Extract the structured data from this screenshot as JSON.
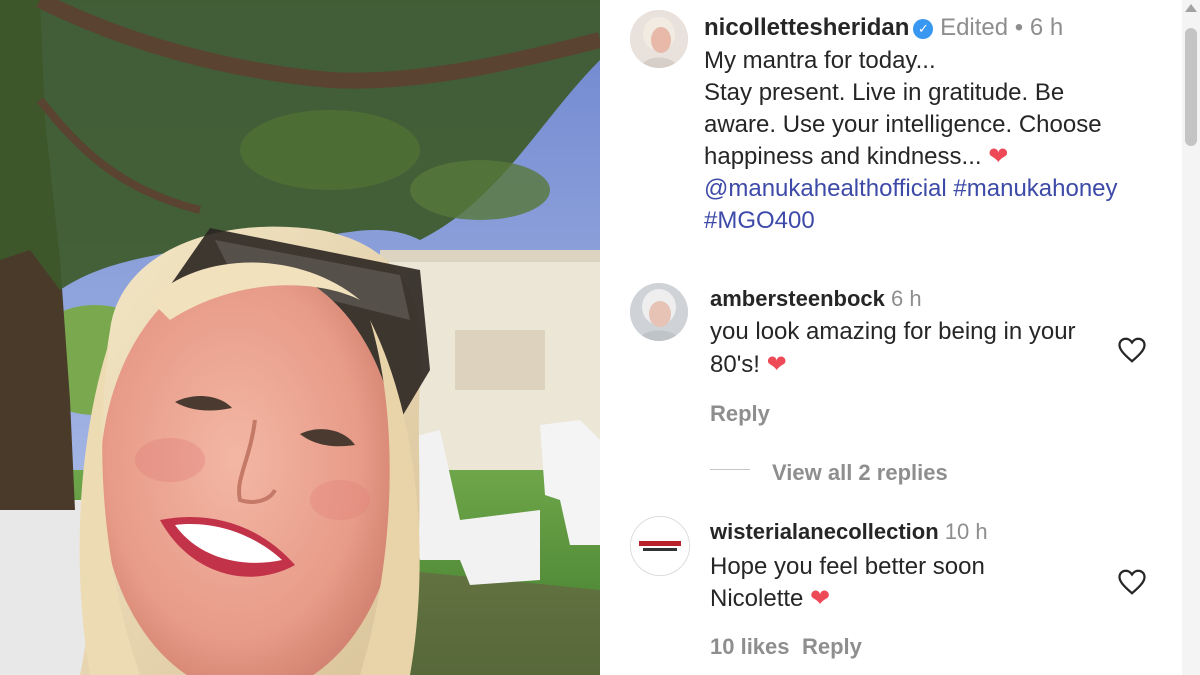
{
  "post": {
    "username": "nicollettesheridan",
    "edited": "Edited",
    "dot": "•",
    "time": "6 h",
    "caption_lines": [
      "My mantra for today...",
      "Stay present. Live in gratitude. Be",
      "aware. Use your intelligence. Choose",
      "happiness and kindness..."
    ],
    "heart": "❤️",
    "mention": "@manukahealthofficial",
    "hashtag_1": "#manukahoney",
    "hashtag_2": "#MGO400"
  },
  "comments": [
    {
      "username": "ambersteenbock",
      "time": "6 h",
      "text_line_1": "you look amazing for being in your",
      "text_line_2": "80's!",
      "heart": "❤️",
      "reply_label": "Reply",
      "view_replies": "View all 2 replies"
    },
    {
      "username": "wisterialanecollection",
      "time": "10 h",
      "text_line_1": "Hope you feel better soon",
      "text_line_2": "Nicolette",
      "heart": "❤️",
      "likes": "10 likes",
      "reply_label": "Reply"
    }
  ],
  "icons": {
    "verified": "verified-badge-icon",
    "like": "heart-outline-icon"
  },
  "colors": {
    "accent_blue": "#3d4aa8",
    "verified_blue": "#3897f0",
    "heart_red": "#ed4956",
    "muted": "#8e8e8e"
  }
}
